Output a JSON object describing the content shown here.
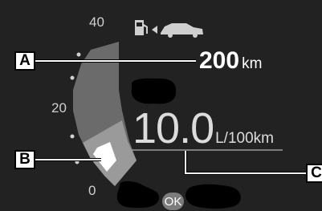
{
  "scale": {
    "max": "40",
    "mid": "20",
    "min": "0"
  },
  "range": {
    "value": "200",
    "unit": "km"
  },
  "consumption": {
    "value": "10.0",
    "unit": "L/100km"
  },
  "callouts": {
    "a": "A",
    "b": "B",
    "c": "C"
  },
  "controls": {
    "ok_label": "OK"
  },
  "icons": {
    "fuel": "fuel-pump-icon",
    "arrow": "left-arrow-icon",
    "car": "car-icon"
  },
  "colors": {
    "background": "#222222",
    "gauge_track": "#6b6b6b",
    "gauge_fill": "#9a9a9a",
    "gauge_current": "#ffffff",
    "text": "#ffffff"
  }
}
